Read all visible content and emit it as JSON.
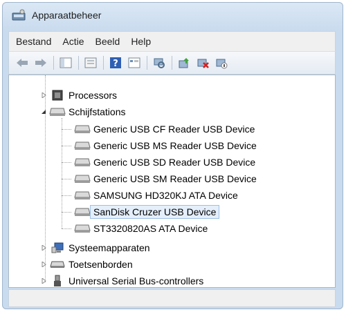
{
  "window": {
    "title": "Apparaatbeheer",
    "app_icon": "device-manager-icon"
  },
  "menu": [
    "Bestand",
    "Actie",
    "Beeld",
    "Help"
  ],
  "toolbar": {
    "buttons": [
      "back-arrow-icon",
      "forward-arrow-icon",
      "show-hide-tree-icon",
      "properties-icon",
      "help-icon",
      "view-icon",
      "scan-hardware-icon",
      "update-driver-icon",
      "uninstall-icon",
      "disable-icon"
    ]
  },
  "tree": {
    "nodes": [
      {
        "label": "Processors",
        "icon": "processor-icon",
        "expanded": false
      },
      {
        "label": "Schijfstations",
        "icon": "disk-drive-icon",
        "expanded": true
      },
      {
        "label": "Generic USB CF Reader USB Device",
        "icon": "disk-drive-icon",
        "child": true
      },
      {
        "label": "Generic USB MS Reader USB Device",
        "icon": "disk-drive-icon",
        "child": true
      },
      {
        "label": "Generic USB SD Reader USB Device",
        "icon": "disk-drive-icon",
        "child": true
      },
      {
        "label": "Generic USB SM Reader USB Device",
        "icon": "disk-drive-icon",
        "child": true
      },
      {
        "label": "SAMSUNG HD320KJ ATA Device",
        "icon": "disk-drive-icon",
        "child": true
      },
      {
        "label": "SanDisk Cruzer USB Device",
        "icon": "disk-drive-icon",
        "child": true,
        "selected": true
      },
      {
        "label": "ST3320820AS ATA Device",
        "icon": "disk-drive-icon",
        "child": true
      },
      {
        "label": "Systeemapparaten",
        "icon": "system-devices-icon",
        "expanded": false
      },
      {
        "label": "Toetsenborden",
        "icon": "keyboard-icon",
        "expanded": false
      },
      {
        "label": "Universal Serial Bus-controllers",
        "icon": "usb-controller-icon",
        "expanded": false
      }
    ]
  },
  "colors": {
    "selection": "#e4effb",
    "selection_border": "#9dc0e6",
    "frame": "#c9dbee"
  }
}
